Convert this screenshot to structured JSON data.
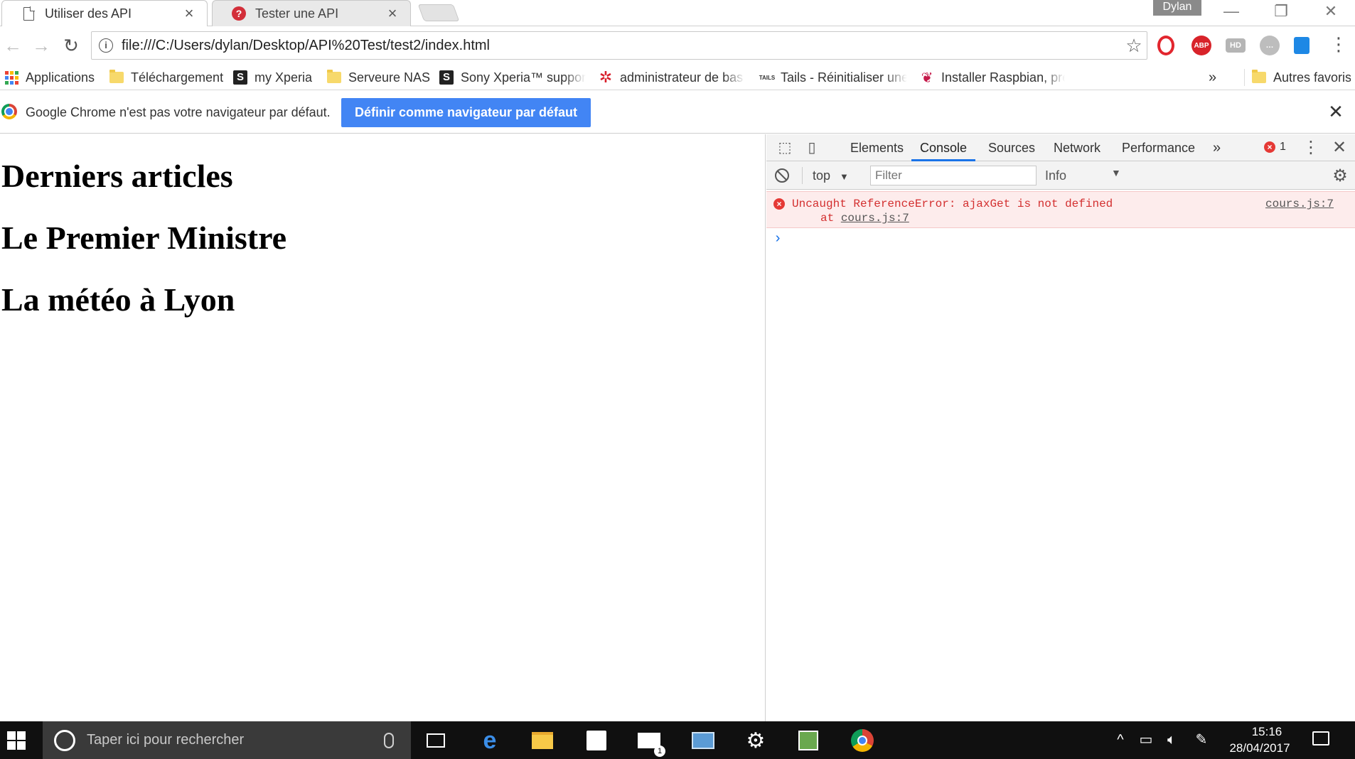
{
  "tabs": [
    {
      "title": "Utiliser des API",
      "icon": "document-icon",
      "active": true
    },
    {
      "title": "Tester une API",
      "icon": "question-icon",
      "active": false
    }
  ],
  "tab_close_glyph": "×",
  "profile_name": "Dylan",
  "window_controls": {
    "minimize": "—",
    "restore": "❐",
    "close": "✕"
  },
  "toolbar": {
    "back_glyph": "←",
    "forward_glyph": "→",
    "reload_glyph": "↻",
    "info_glyph": "i",
    "url": "file:///C:/Users/dylan/Desktop/API%20Test/test2/index.html",
    "star_glyph": "☆",
    "menu_glyph": "⋮",
    "extensions": [
      {
        "name": "opera-icon",
        "label": "O",
        "color": "#e2262e"
      },
      {
        "name": "adblock-plus-icon",
        "label": "ABP",
        "color": "#d8232a"
      },
      {
        "name": "hd-icon",
        "label": "HD",
        "color": "#b5b5b5"
      },
      {
        "name": "chat-icon",
        "label": "…",
        "color": "#bdbdbd"
      },
      {
        "name": "trello-icon",
        "label": "",
        "color": "#1e88e5"
      }
    ]
  },
  "bookmarks": [
    {
      "label": "Applications",
      "icon": "apps-grid-icon"
    },
    {
      "label": "Téléchargement",
      "icon": "folder-icon"
    },
    {
      "label": "my Xperia",
      "icon": "s-logo-icon"
    },
    {
      "label": "Serveure NAS",
      "icon": "folder-icon"
    },
    {
      "label": "Sony Xperia™ support",
      "icon": "s-logo-icon"
    },
    {
      "label": "administrateur de bas",
      "icon": "huawei-icon"
    },
    {
      "label": "Tails - Réinitialiser une",
      "icon": "tails-icon"
    },
    {
      "label": "Installer Raspbian, pre",
      "icon": "raspberry-icon"
    }
  ],
  "bookmarks_overflow": "»",
  "other_bookmarks": "Autres favoris",
  "tails_prefix": "TAILS",
  "infobar": {
    "message": "Google Chrome n'est pas votre navigateur par défaut.",
    "button": "Définir comme navigateur par défaut",
    "close_glyph": "✕"
  },
  "page": {
    "headings": [
      "Derniers articles",
      "Le Premier Ministre",
      "La météo à Lyon"
    ]
  },
  "devtools": {
    "tabs": [
      "Elements",
      "Console",
      "Sources",
      "Network",
      "Performance"
    ],
    "active_tab": "Console",
    "more_tabs_glyph": "»",
    "error_count": "1",
    "context": "top",
    "context_arrow": "▼",
    "filter_placeholder": "Filter",
    "level": "Info",
    "level_arrow": "▼",
    "console": {
      "error_message": "Uncaught ReferenceError: ajaxGet is not defined",
      "trace_prefix": "at ",
      "trace_link": "cours.js:7",
      "source": "cours.js:7",
      "prompt": "›"
    }
  },
  "taskbar": {
    "search_placeholder": "Taper ici pour rechercher",
    "apps": [
      "task-view-icon",
      "edge-icon",
      "file-explorer-icon",
      "store-icon",
      "mail-icon",
      "remote-desktop-icon",
      "settings-icon",
      "app-icon",
      "chrome-icon"
    ],
    "mail_badge": "1",
    "time": "15:16",
    "date": "28/04/2017"
  }
}
